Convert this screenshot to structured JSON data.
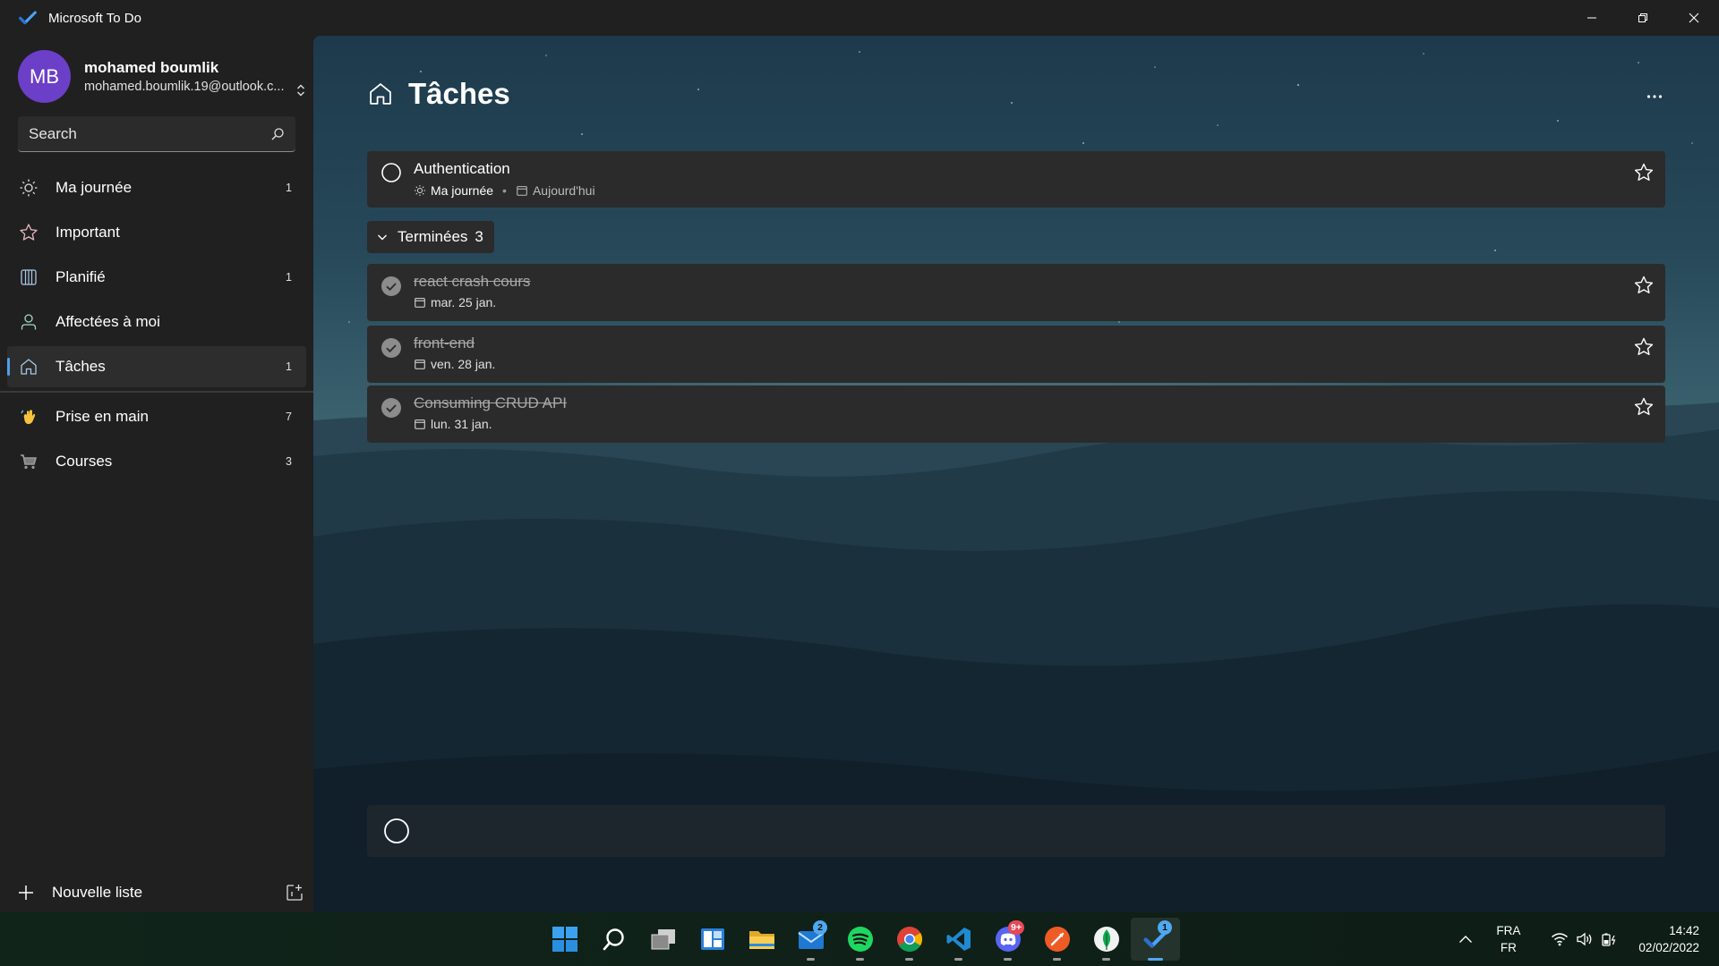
{
  "window": {
    "title": "Microsoft To Do"
  },
  "profile": {
    "initials": "MB",
    "name": "mohamed boumlik",
    "email": "mohamed.boumlik.19@outlook.c...",
    "avatar_color": "#6b3fc7"
  },
  "search": {
    "placeholder": "Search"
  },
  "sidebar": {
    "items": [
      {
        "label": "Ma journée",
        "count": "1",
        "icon": "sun-icon"
      },
      {
        "label": "Important",
        "count": "",
        "icon": "star-icon"
      },
      {
        "label": "Planifié",
        "count": "1",
        "icon": "calendar-grid-icon"
      },
      {
        "label": "Affectées à moi",
        "count": "",
        "icon": "person-icon"
      },
      {
        "label": "Tâches",
        "count": "1",
        "icon": "home-icon",
        "active": true
      }
    ],
    "lists": [
      {
        "label": "Prise en main",
        "count": "7",
        "icon": "waving-hand-icon"
      },
      {
        "label": "Courses",
        "count": "3",
        "icon": "shopping-cart-icon"
      }
    ],
    "new_list_label": "Nouvelle liste"
  },
  "main": {
    "title": "Tâches",
    "tasks": [
      {
        "title": "Authentication",
        "myday": "Ma journée",
        "separator": "•",
        "due": "Aujourd'hui",
        "completed": false
      }
    ],
    "completed_section": {
      "label": "Terminées",
      "count": "3"
    },
    "completed_tasks": [
      {
        "title": "react crash cours",
        "due": "mar. 25 jan."
      },
      {
        "title": "front-end",
        "due": "ven. 28 jan."
      },
      {
        "title": "Consuming CRUD API",
        "due": "lun. 31 jan."
      }
    ],
    "add_task_placeholder": ""
  },
  "taskbar": {
    "apps": [
      {
        "name": "start",
        "icon": "windows-start-icon"
      },
      {
        "name": "search",
        "icon": "search-icon"
      },
      {
        "name": "task-view",
        "icon": "task-view-icon"
      },
      {
        "name": "widgets",
        "icon": "widgets-icon"
      },
      {
        "name": "file-explorer",
        "icon": "folder-icon"
      },
      {
        "name": "mail",
        "icon": "mail-icon",
        "badge": "2"
      },
      {
        "name": "spotify",
        "icon": "spotify-icon"
      },
      {
        "name": "chrome",
        "icon": "chrome-icon"
      },
      {
        "name": "vscode",
        "icon": "vscode-icon"
      },
      {
        "name": "discord",
        "icon": "discord-icon",
        "badge": "9+"
      },
      {
        "name": "postman",
        "icon": "postman-icon"
      },
      {
        "name": "mongodb-compass",
        "icon": "mongodb-icon"
      },
      {
        "name": "microsoft-to-do",
        "icon": "todo-icon",
        "badge": "1",
        "active": true
      }
    ],
    "tray": {
      "lang_top": "FRA",
      "lang_bottom": "FR",
      "time": "14:42",
      "date": "02/02/2022"
    }
  },
  "colors": {
    "accent": "#4f9ee8",
    "sidebar_bg": "#202020",
    "card_bg": "#2b2b2b"
  }
}
